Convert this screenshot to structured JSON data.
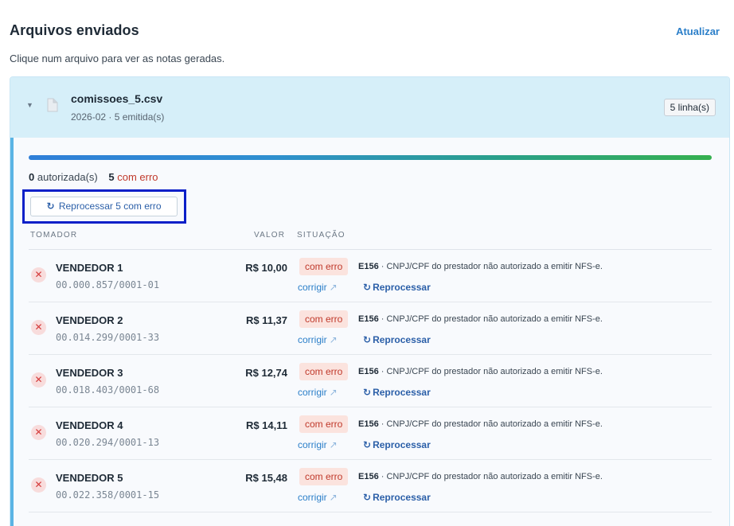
{
  "header": {
    "title": "Arquivos enviados",
    "refresh_label": "Atualizar",
    "subtitle": "Clique num arquivo para ver as notas geradas."
  },
  "file": {
    "name": "comissoes_5.csv",
    "meta": "2026-02 · 5 emitida(s)",
    "lines_badge": "5 linha(s)",
    "counts": {
      "authorized_count": "0",
      "authorized_label": "autorizada(s)",
      "error_count": "5",
      "error_label": "com erro"
    },
    "reprocess_all_label": "Reprocessar 5 com erro",
    "progress_fraction": 1.0
  },
  "table": {
    "headers": {
      "tomador": "TOMADOR",
      "valor": "VALOR",
      "situacao": "SITUAÇÃO"
    },
    "rows": [
      {
        "name": "VENDEDOR 1",
        "doc": "00.000.857/0001-01",
        "value": "R$ 10,00",
        "status": "com erro",
        "code": "E156",
        "message": " · CNPJ/CPF do prestador não autorizado a emitir NFS-e.",
        "fix": "corrigir",
        "reprocess": "Reprocessar"
      },
      {
        "name": "VENDEDOR 2",
        "doc": "00.014.299/0001-33",
        "value": "R$ 11,37",
        "status": "com erro",
        "code": "E156",
        "message": " · CNPJ/CPF do prestador não autorizado a emitir NFS-e.",
        "fix": "corrigir",
        "reprocess": "Reprocessar"
      },
      {
        "name": "VENDEDOR 3",
        "doc": "00.018.403/0001-68",
        "value": "R$ 12,74",
        "status": "com erro",
        "code": "E156",
        "message": " · CNPJ/CPF do prestador não autorizado a emitir NFS-e.",
        "fix": "corrigir",
        "reprocess": "Reprocessar"
      },
      {
        "name": "VENDEDOR 4",
        "doc": "00.020.294/0001-13",
        "value": "R$ 14,11",
        "status": "com erro",
        "code": "E156",
        "message": " · CNPJ/CPF do prestador não autorizado a emitir NFS-e.",
        "fix": "corrigir",
        "reprocess": "Reprocessar"
      },
      {
        "name": "VENDEDOR 5",
        "doc": "00.022.358/0001-15",
        "value": "R$ 15,48",
        "status": "com erro",
        "code": "E156",
        "message": " · CNPJ/CPF do prestador não autorizado a emitir NFS-e.",
        "fix": "corrigir",
        "reprocess": "Reprocessar"
      }
    ]
  },
  "colors": {
    "accent": "#2b7fc9",
    "error": "#c0392b",
    "card_header_bg": "#d6eff9",
    "highlight_border": "#0b1fc8"
  },
  "icons": {
    "chevron": "chevron-down-icon",
    "file": "file-icon",
    "row_status": "x-circle-icon",
    "external": "arrow-up-right-icon",
    "reprocess": "refresh-icon"
  }
}
